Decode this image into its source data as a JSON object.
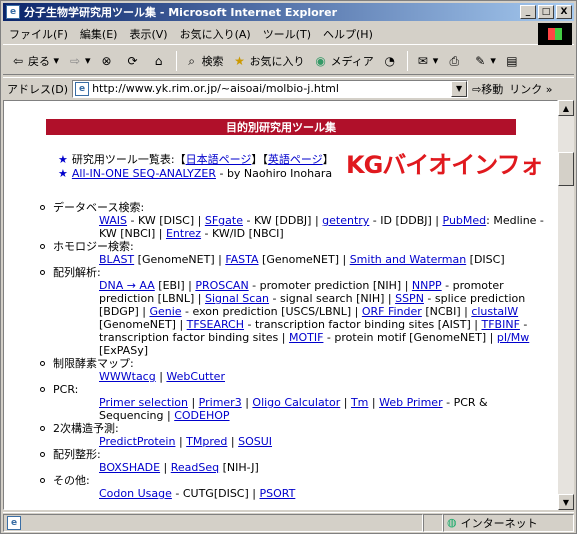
{
  "window": {
    "title": "分子生物学研究用ツール集 - Microsoft Internet Explorer",
    "min": "_",
    "max": "□",
    "close": "X"
  },
  "menu": [
    "ファイル(F)",
    "編集(E)",
    "表示(V)",
    "お気に入り(A)",
    "ツール(T)",
    "ヘルプ(H)"
  ],
  "toolbar": {
    "back": "戻る",
    "search": "検索",
    "favorites": "お気に入り",
    "media": "メディア"
  },
  "address": {
    "label": "アドレス(D)",
    "url": "http://www.yk.rim.or.jp/~aisoai/molbio-j.html",
    "go": "移動",
    "links": "リンク"
  },
  "status": {
    "zone": "インターネット"
  },
  "page": {
    "banner": "目的別研究用ツール集",
    "overlay": "KGバイオインフォ",
    "intro1_prefix": "研究用ツール一覧表:【",
    "intro1_ja": "日本語ページ",
    "intro1_mid": "】【",
    "intro1_en": "英語ページ",
    "intro1_suffix": "】",
    "intro2_link": "All-IN-ONE SEQ-ANALYZER",
    "intro2_rest": " - by Naohiro Inohara",
    "categories": [
      {
        "title": "データベース検索:",
        "items": [
          {
            "t": "WAIS",
            "l": true
          },
          {
            "t": " - KW [DISC] | "
          },
          {
            "t": "SFgate",
            "l": true
          },
          {
            "t": " - KW [DDBJ] | "
          },
          {
            "t": "getentry",
            "l": true
          },
          {
            "t": " - ID [DDBJ] | "
          },
          {
            "t": "PubMed",
            "l": true
          },
          {
            "t": ": Medline - KW [NBCI] | "
          },
          {
            "t": "Entrez",
            "l": true
          },
          {
            "t": " - KW/ID [NBCI]"
          }
        ]
      },
      {
        "title": "ホモロジー検索:",
        "items": [
          {
            "t": "BLAST",
            "l": true
          },
          {
            "t": " [GenomeNET] | "
          },
          {
            "t": "FASTA",
            "l": true
          },
          {
            "t": " [GenomeNET] | "
          },
          {
            "t": "Smith and Waterman",
            "l": true
          },
          {
            "t": " [DISC]"
          }
        ]
      },
      {
        "title": "配列解析:",
        "items": [
          {
            "t": "DNA → AA",
            "l": true
          },
          {
            "t": " [EBI] | "
          },
          {
            "t": "PROSCAN",
            "l": true
          },
          {
            "t": " - promoter prediction [NIH] | "
          },
          {
            "t": "NNPP",
            "l": true
          },
          {
            "t": " - promoter prediction [LBNL] | "
          },
          {
            "t": "Signal Scan",
            "l": true
          },
          {
            "t": " - signal search [NIH] | "
          },
          {
            "t": "SSPN",
            "l": true
          },
          {
            "t": " - splice prediction [BDGP] | "
          },
          {
            "t": "Genie",
            "l": true
          },
          {
            "t": " - exon prediction [USCS/LBNL] | "
          },
          {
            "t": "ORF Finder",
            "l": true
          },
          {
            "t": " [NCBI] | "
          },
          {
            "t": "clustalW",
            "l": true
          },
          {
            "t": " [GenomeNET] | "
          },
          {
            "t": "TFSEARCH",
            "l": true
          },
          {
            "t": " - transcription factor binding sites [AIST] | "
          },
          {
            "t": "TFBINF",
            "l": true
          },
          {
            "t": " - transcription factor binding sites | "
          },
          {
            "t": "MOTIF",
            "l": true
          },
          {
            "t": " - protein motif [GenomeNET] | "
          },
          {
            "t": "pI/Mw",
            "l": true
          },
          {
            "t": " [ExPASy]"
          }
        ]
      },
      {
        "title": "制限酵素マップ:",
        "items": [
          {
            "t": "WWWtacg",
            "l": true
          },
          {
            "t": " | "
          },
          {
            "t": "WebCutter",
            "l": true
          }
        ]
      },
      {
        "title": "PCR:",
        "items": [
          {
            "t": "Primer selection",
            "l": true
          },
          {
            "t": " | "
          },
          {
            "t": "Primer3",
            "l": true
          },
          {
            "t": " | "
          },
          {
            "t": "Oligo Calculator",
            "l": true
          },
          {
            "t": " | "
          },
          {
            "t": "Tm",
            "l": true
          },
          {
            "t": " | "
          },
          {
            "t": "Web Primer",
            "l": true
          },
          {
            "t": " - PCR & Sequencing | "
          },
          {
            "t": "CODEHOP",
            "l": true
          }
        ]
      },
      {
        "title": "2次構造予測:",
        "items": [
          {
            "t": "PredictProtein",
            "l": true
          },
          {
            "t": " | "
          },
          {
            "t": "TMpred",
            "l": true
          },
          {
            "t": " | "
          },
          {
            "t": "SOSUI",
            "l": true
          }
        ]
      },
      {
        "title": "配列整形:",
        "items": [
          {
            "t": "BOXSHADE",
            "l": true
          },
          {
            "t": " | "
          },
          {
            "t": "ReadSeq",
            "l": true
          },
          {
            "t": " [NIH-J]"
          }
        ]
      },
      {
        "title": "その他:",
        "items": [
          {
            "t": "Codon Usage",
            "l": true
          },
          {
            "t": " - CUTG[DISC] | "
          },
          {
            "t": "PSORT",
            "l": true
          }
        ]
      }
    ]
  }
}
